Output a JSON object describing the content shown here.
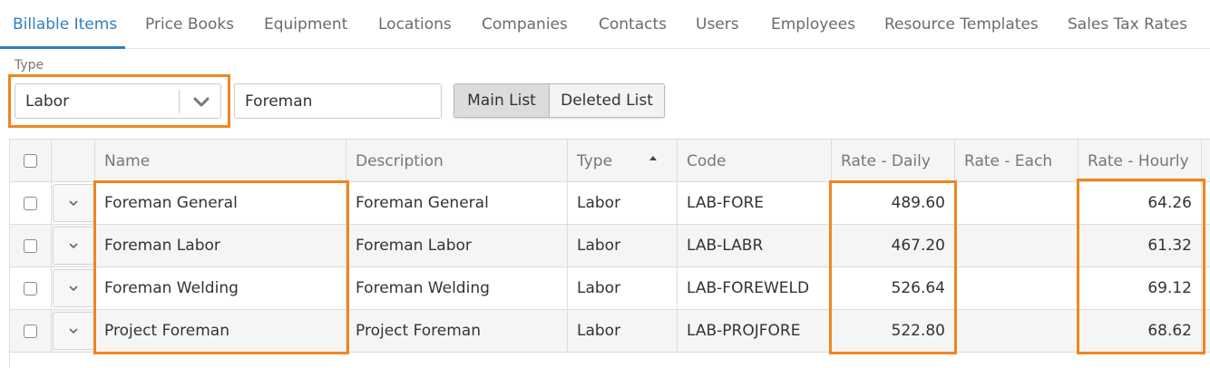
{
  "tabs": [
    {
      "label": "Billable Items",
      "active": true
    },
    {
      "label": "Price Books"
    },
    {
      "label": "Equipment"
    },
    {
      "label": "Locations"
    },
    {
      "label": "Companies"
    },
    {
      "label": "Contacts"
    },
    {
      "label": "Users"
    },
    {
      "label": "Employees"
    },
    {
      "label": "Resource Templates"
    },
    {
      "label": "Sales Tax Rates"
    }
  ],
  "filters": {
    "type_label": "Type",
    "type_value": "Labor",
    "search_value": "Foreman",
    "main_list_label": "Main List",
    "deleted_list_label": "Deleted List"
  },
  "grid": {
    "columns": [
      "Name",
      "Description",
      "Type",
      "Code",
      "Rate - Daily",
      "Rate - Each",
      "Rate - Hourly"
    ],
    "sort_column": "Type",
    "sort_direction": "ascending",
    "rows": [
      {
        "name": "Foreman General",
        "description": "Foreman General",
        "type": "Labor",
        "code": "LAB-FORE",
        "rate_daily": "489.60",
        "rate_each": "",
        "rate_hourly": "64.26"
      },
      {
        "name": "Foreman Labor",
        "description": "Foreman Labor",
        "type": "Labor",
        "code": "LAB-LABR",
        "rate_daily": "467.20",
        "rate_each": "",
        "rate_hourly": "61.32"
      },
      {
        "name": "Foreman Welding",
        "description": "Foreman Welding",
        "type": "Labor",
        "code": "LAB-FOREWELD",
        "rate_daily": "526.64",
        "rate_each": "",
        "rate_hourly": "69.12"
      },
      {
        "name": "Project Foreman",
        "description": "Project Foreman",
        "type": "Labor",
        "code": "LAB-PROJFORE",
        "rate_daily": "522.80",
        "rate_each": "",
        "rate_hourly": "68.62"
      }
    ]
  },
  "colors": {
    "accent": "#2f7fbf",
    "highlight": "#f0851e"
  },
  "icons": {
    "dropdown": "chevron-down-icon",
    "row_expand": "chevron-down-icon",
    "sort": "sort-up-icon"
  }
}
